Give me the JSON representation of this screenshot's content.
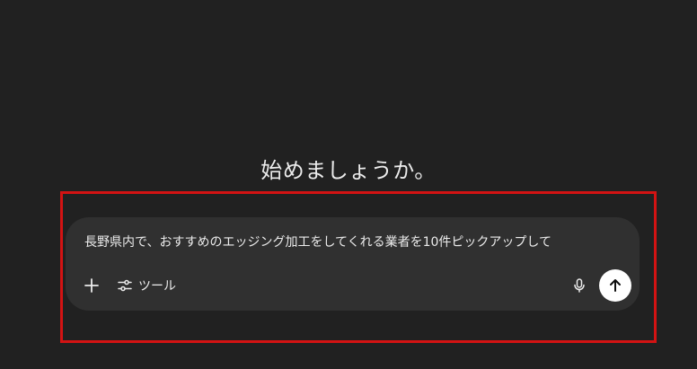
{
  "greeting": "始めましょうか。",
  "composer": {
    "text": "長野県内で、おすすめのエッジング加工をしてくれる業者を10件ピックアップして",
    "tools_label": "ツール"
  },
  "icons": {
    "plus": "plus-icon",
    "tools": "sliders-icon",
    "mic": "microphone-icon",
    "send": "arrow-up-icon"
  },
  "colors": {
    "background": "#212121",
    "composer": "#303030",
    "highlight": "#d31313",
    "send_button": "#ffffff"
  }
}
